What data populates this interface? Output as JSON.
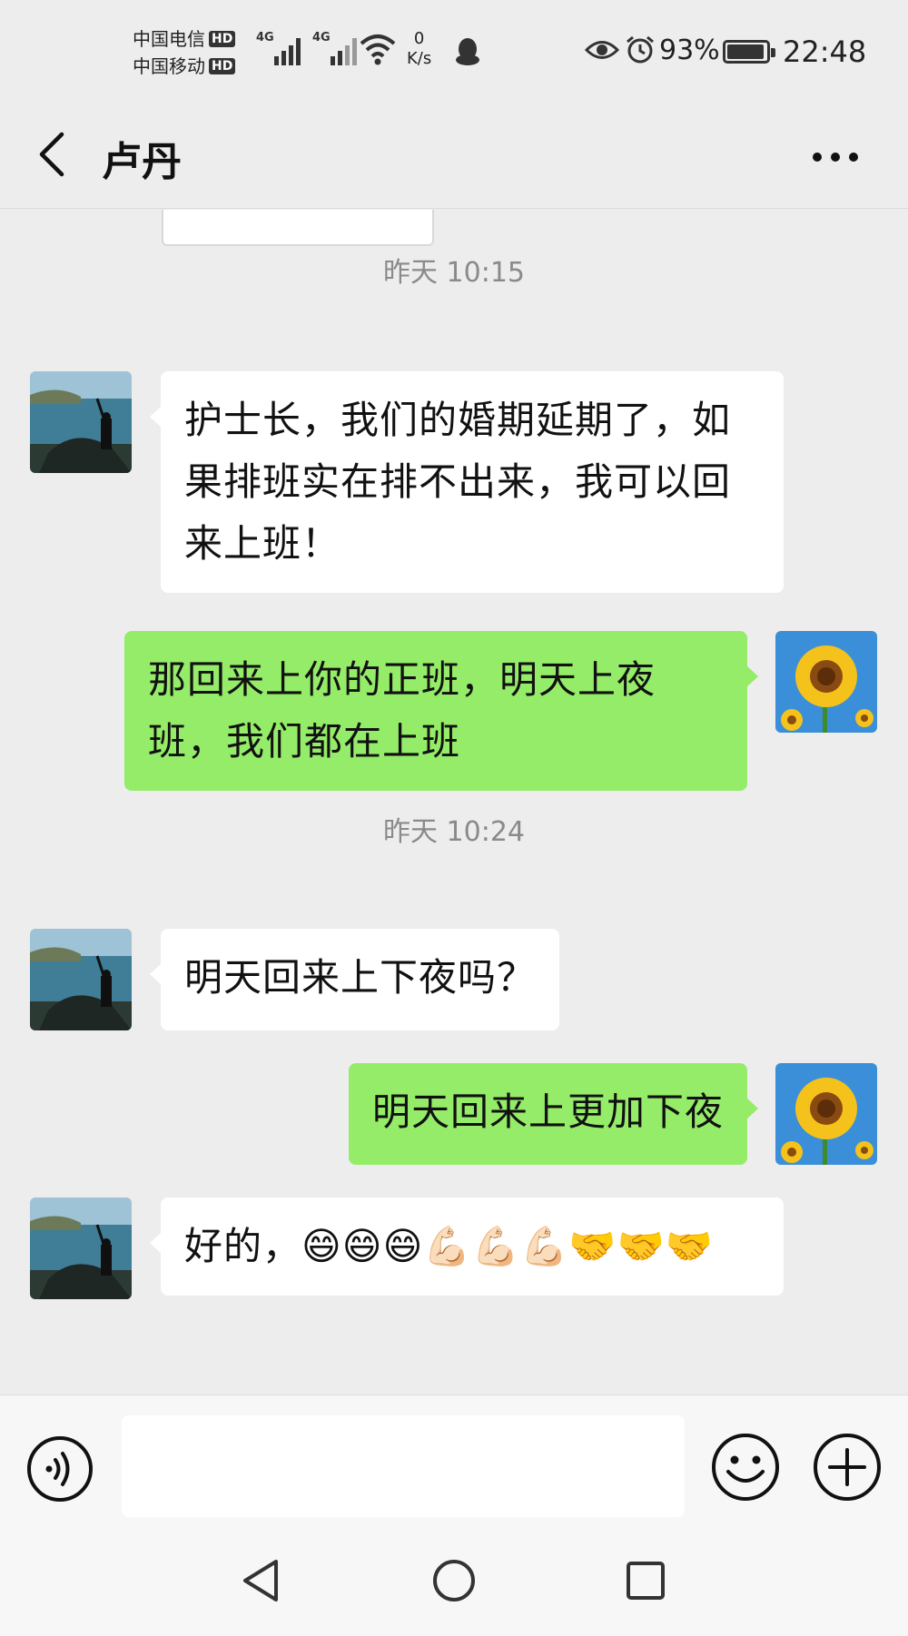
{
  "status_bar": {
    "carrier_1": "中国电信",
    "carrier_2": "中国移动",
    "hd_badge": "HD",
    "signal_label": "4G",
    "net_speed_value": "0",
    "net_speed_unit": "K/s",
    "battery_percent": "93%",
    "time": "22:48"
  },
  "header": {
    "title": "卢丹"
  },
  "messages": [
    {
      "type": "time",
      "text": "昨天 10:15"
    },
    {
      "type": "in",
      "text": "护士长，我们的婚期延期了，如果排班实在排不出来，我可以回来上班！"
    },
    {
      "type": "out",
      "text": "那回来上你的正班，明天上夜班，我们都在上班"
    },
    {
      "type": "time",
      "text": "昨天 10:24"
    },
    {
      "type": "in",
      "text": "明天回来上下夜吗？"
    },
    {
      "type": "out",
      "text": "明天回来上更加下夜"
    },
    {
      "type": "in",
      "text": "好的，😄😄😄💪🏻💪🏻💪🏻🤝🤝🤝"
    }
  ],
  "input_bar": {
    "placeholder": "",
    "value": ""
  },
  "colors": {
    "background": "#ededed",
    "outgoing_bubble": "#95ec69",
    "incoming_bubble": "#ffffff"
  },
  "icons": {
    "back": "chevron-left-icon",
    "more": "more-dots-icon",
    "voice": "voice-icon",
    "emoji": "smiley-icon",
    "plus": "plus-circle-icon"
  }
}
